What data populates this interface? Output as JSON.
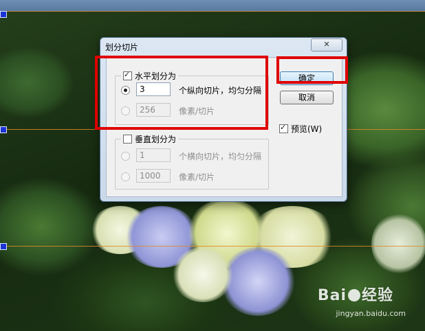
{
  "dialog": {
    "title": "划分切片",
    "horizontal": {
      "checkbox_label": "水平划分为",
      "checked": true,
      "option_count": {
        "value": "3",
        "suffix": "个纵向切片，均匀分隔",
        "selected": true
      },
      "option_pixels": {
        "value": "256",
        "suffix": "像素/切片",
        "selected": false
      }
    },
    "vertical": {
      "checkbox_label": "垂直划分为",
      "checked": false,
      "option_count": {
        "value": "1",
        "suffix": "个横向切片，均匀分隔"
      },
      "option_pixels": {
        "value": "1000",
        "suffix": "像素/切片"
      }
    },
    "buttons": {
      "ok": "确定",
      "cancel": "取消"
    },
    "preview": {
      "label": "预览(W)",
      "checked": true
    }
  },
  "watermark": {
    "brand": "Bai",
    "brand2": "经验",
    "url": "jingyan.baidu.com"
  },
  "colors": {
    "highlight": "#e00000",
    "guide": "#e28a2a",
    "slice_tag": "#1b33d6"
  },
  "icons": [
    "close-icon",
    "checkbox-icon",
    "radio-icon",
    "baidu-paw-icon"
  ]
}
